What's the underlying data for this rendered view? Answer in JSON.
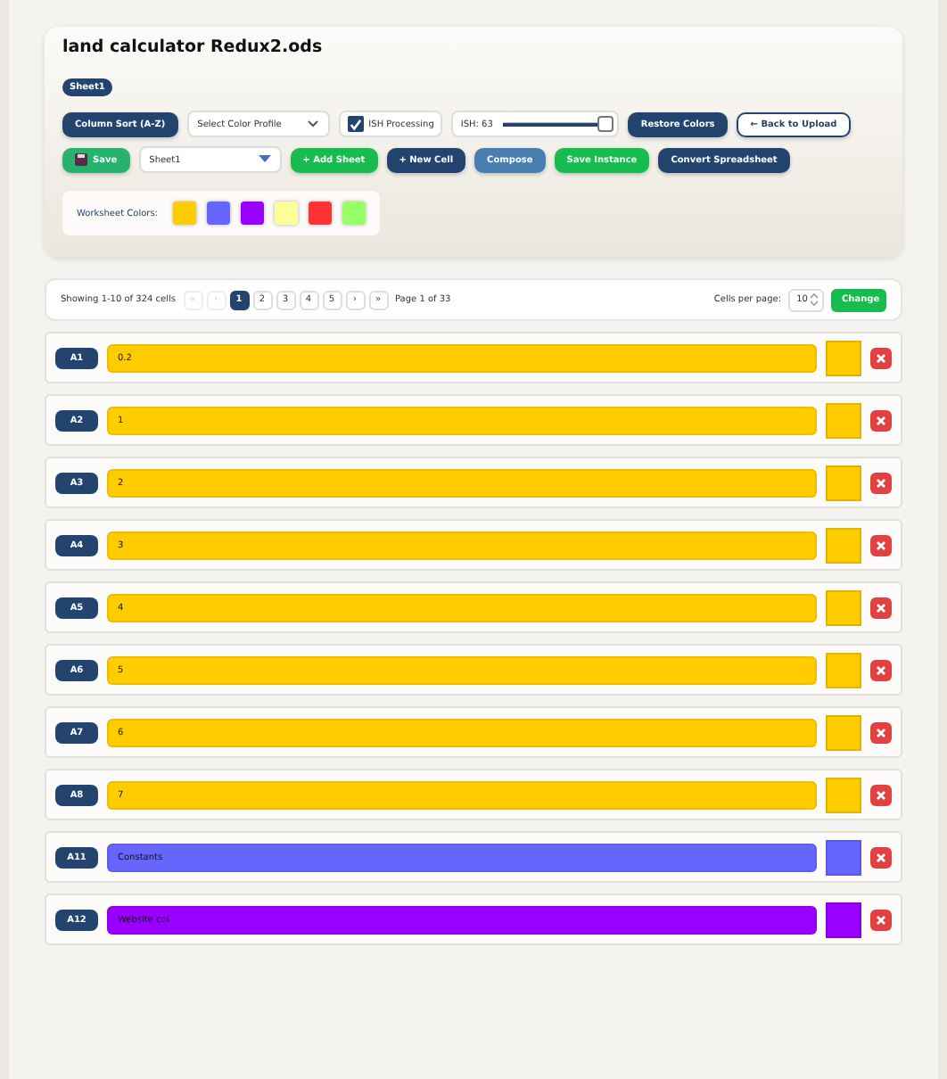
{
  "title": "land calculator Redux2.ods",
  "sheet_badge": "Sheet1",
  "toolbar_row1": [
    {
      "kind": "dark",
      "label": "Column Sort (A-Z)"
    },
    {
      "kind": "select",
      "label": "Select Color Profile"
    },
    {
      "kind": "checkbox",
      "label": "ISH Processing",
      "checked": true
    },
    {
      "kind": "slider",
      "label": "ISH: 63",
      "level": 0.95
    },
    {
      "kind": "dark",
      "label": "Restore Colors"
    },
    {
      "kind": "outline",
      "label": "← Back to Upload"
    }
  ],
  "toolbar_row2": [
    {
      "kind": "green",
      "label": "Save"
    },
    {
      "kind": "select",
      "label": "Sheet1"
    },
    {
      "kind": "bright",
      "label": "+ Add Sheet"
    },
    {
      "kind": "dark",
      "label": "+ New Cell"
    },
    {
      "kind": "blue",
      "label": "Compose"
    },
    {
      "kind": "bright",
      "label": "Save Instance"
    },
    {
      "kind": "dark",
      "label": "Convert Spreadsheet"
    }
  ],
  "worksheet_colors": {
    "label": "Worksheet Colors:",
    "swatches": [
      {
        "color": "#ffcc00"
      },
      {
        "color": "#6666ff"
      },
      {
        "color": "#9900ff"
      },
      {
        "color": "#ffff99"
      },
      {
        "color": "#ff3333"
      },
      {
        "color": "#99ff66"
      }
    ]
  },
  "pagination": {
    "summary": "Showing 1-10 of 324 cells",
    "pages": [
      {
        "label": "«",
        "disabled": true,
        "selected": false
      },
      {
        "label": "‹",
        "disabled": true,
        "selected": false
      },
      {
        "label": "1",
        "disabled": false,
        "selected": true
      },
      {
        "label": "2",
        "disabled": false,
        "selected": false
      },
      {
        "label": "3",
        "disabled": false,
        "selected": false
      },
      {
        "label": "4",
        "disabled": false,
        "selected": false
      },
      {
        "label": "5",
        "disabled": false,
        "selected": false
      },
      {
        "label": "›",
        "disabled": false,
        "selected": false
      },
      {
        "label": "»",
        "disabled": false,
        "selected": false
      }
    ],
    "page_info": "Page 1 of 33",
    "per_page_label": "Cells per page:",
    "per_page": "10",
    "change": "Change"
  },
  "cells": [
    {
      "ref": "A1",
      "value": "0.2",
      "color": "#ffcc00"
    },
    {
      "ref": "A2",
      "value": "1",
      "color": "#ffcc00"
    },
    {
      "ref": "A3",
      "value": "2",
      "color": "#ffcc00"
    },
    {
      "ref": "A4",
      "value": "3",
      "color": "#ffcc00"
    },
    {
      "ref": "A5",
      "value": "4",
      "color": "#ffcc00"
    },
    {
      "ref": "A6",
      "value": "5",
      "color": "#ffcc00"
    },
    {
      "ref": "A7",
      "value": "6",
      "color": "#ffcc00"
    },
    {
      "ref": "A8",
      "value": "7",
      "color": "#ffcc00"
    },
    {
      "ref": "A11",
      "value": "Constants",
      "color": "#6666ff"
    },
    {
      "ref": "A12",
      "value": "Website col",
      "color": "#9900ff"
    }
  ]
}
